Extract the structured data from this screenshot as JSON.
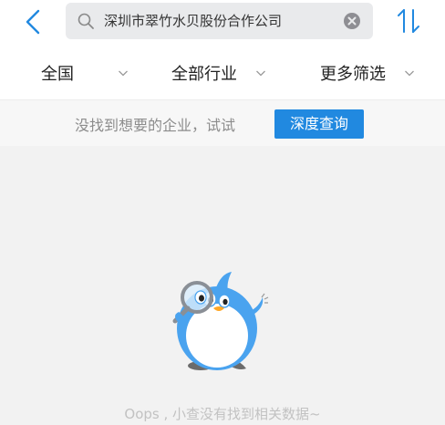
{
  "search": {
    "query": "深圳市翠竹水贝股份合作公司"
  },
  "icons": {
    "back": "chevron-left-icon",
    "search": "search-icon",
    "clear": "clear-circle-icon",
    "sort": "sort-arrows-icon",
    "dropdown": "chevron-down-icon"
  },
  "filters": [
    {
      "label": "全国"
    },
    {
      "label": "全部行业"
    },
    {
      "label": "更多筛选"
    }
  ],
  "hint": {
    "text": "没找到想要的企业，试试",
    "button": "深度查询"
  },
  "empty_state": {
    "message": "Oops , 小查没有找到相关数据~"
  },
  "colors": {
    "accent": "#2189e0",
    "mascot": "#4aa3ef"
  }
}
